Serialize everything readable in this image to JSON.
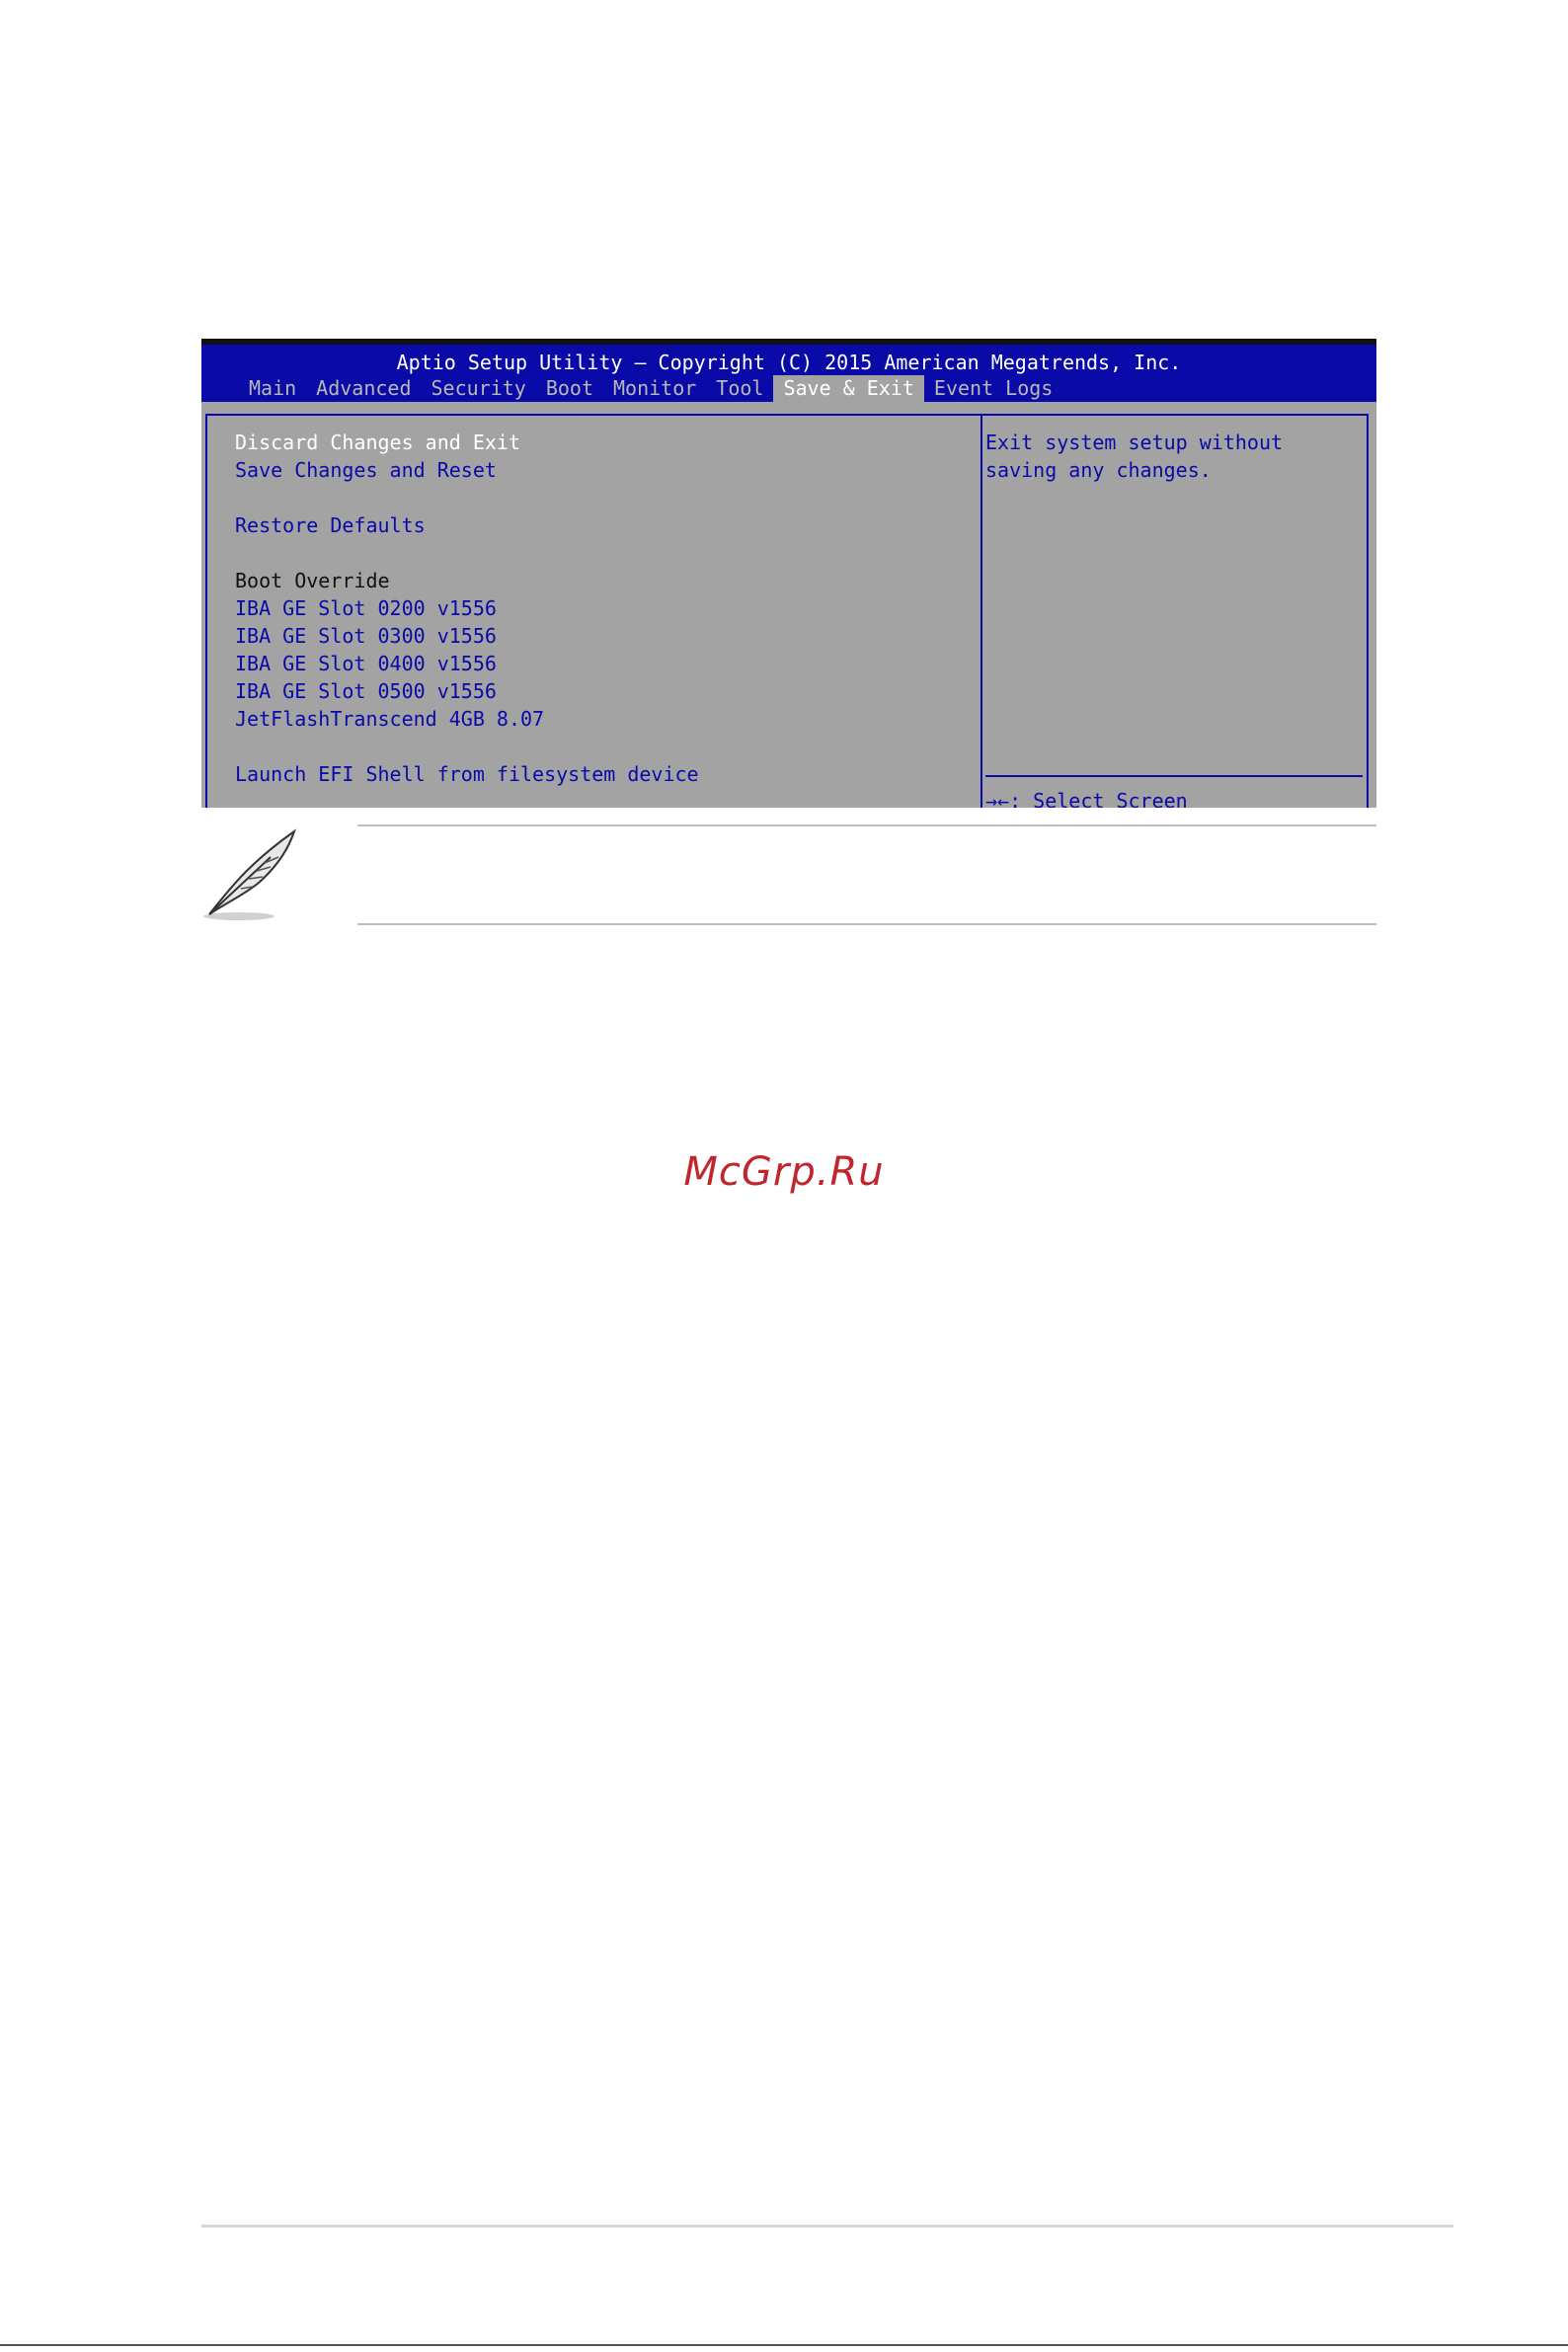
{
  "bios": {
    "title": "Aptio Setup Utility – Copyright (C) 2015 American Megatrends, Inc.",
    "tabs": [
      {
        "label": "Main",
        "active": false
      },
      {
        "label": "Advanced",
        "active": false
      },
      {
        "label": "Security",
        "active": false
      },
      {
        "label": "Boot",
        "active": false
      },
      {
        "label": "Monitor",
        "active": false
      },
      {
        "label": "Tool",
        "active": false
      },
      {
        "label": "Save & Exit",
        "active": true
      },
      {
        "label": "Event Logs",
        "active": false
      }
    ],
    "items": {
      "discard_changes_exit": "Discard Changes and Exit",
      "save_changes_reset": "Save Changes and Reset",
      "restore_defaults": "Restore Defaults",
      "boot_override_heading": "Boot Override",
      "boot_0200": "IBA GE Slot 0200 v1556",
      "boot_0300": "IBA GE Slot 0300 v1556",
      "boot_0400": "IBA GE Slot 0400 v1556",
      "boot_0500": "IBA GE Slot 0500 v1556",
      "boot_jetflash": "JetFlashTranscend 4GB 8.07",
      "launch_efi_shell": "Launch EFI Shell from filesystem device"
    },
    "help": {
      "line1": "Exit system setup without",
      "line2": "saving any changes."
    },
    "keys": {
      "select_screen": "→←: Select Screen"
    },
    "colors": {
      "header_blue": "#0a0aa8",
      "panel_gray": "#a3a3a3",
      "selected_text": "#ffffff"
    }
  },
  "note": {
    "icon": "feather-quill-icon"
  },
  "watermark": {
    "text": "McGrp.Ru",
    "color": "#c0262d"
  }
}
